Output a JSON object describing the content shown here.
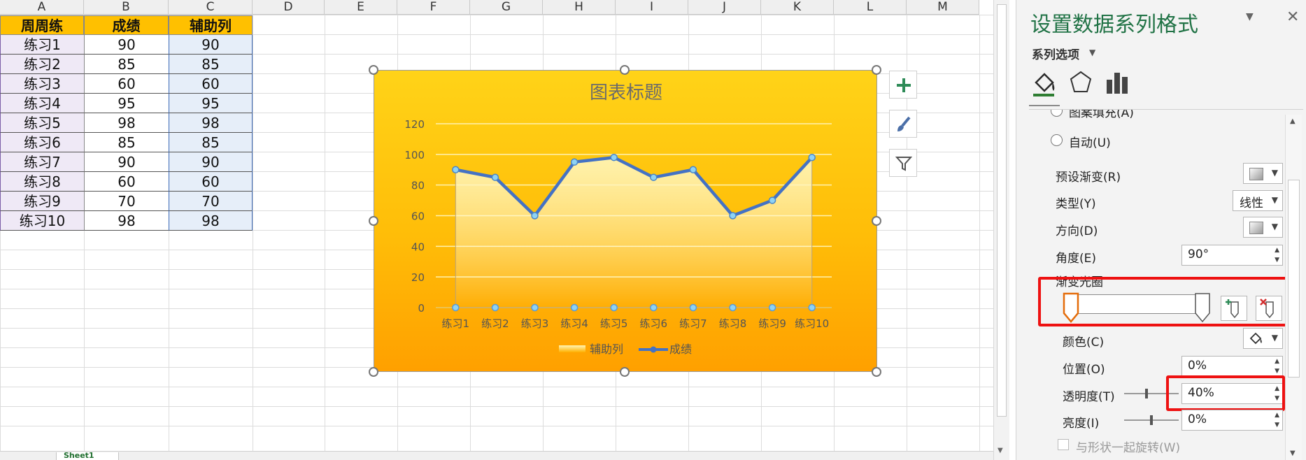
{
  "spreadsheet": {
    "columns": [
      "A",
      "B",
      "C",
      "D",
      "E",
      "F",
      "G",
      "H",
      "I",
      "J",
      "K",
      "L",
      "M"
    ],
    "headers": [
      "周周练",
      "成绩",
      "辅助列"
    ],
    "rows": [
      [
        "练习1",
        "90",
        "90"
      ],
      [
        "练习2",
        "85",
        "85"
      ],
      [
        "练习3",
        "60",
        "60"
      ],
      [
        "练习4",
        "95",
        "95"
      ],
      [
        "练习5",
        "98",
        "98"
      ],
      [
        "练习6",
        "85",
        "85"
      ],
      [
        "练习7",
        "90",
        "90"
      ],
      [
        "练习8",
        "60",
        "60"
      ],
      [
        "练习9",
        "70",
        "70"
      ],
      [
        "练习10",
        "98",
        "98"
      ]
    ],
    "sheet_tab": "Sheet1"
  },
  "chart_data": {
    "type": "line",
    "title": "图表标题",
    "categories": [
      "练习1",
      "练习2",
      "练习3",
      "练习4",
      "练习5",
      "练习6",
      "练习7",
      "练习8",
      "练习9",
      "练习10"
    ],
    "series": [
      {
        "name": "辅助列",
        "type": "area",
        "values": [
          90,
          85,
          60,
          95,
          98,
          85,
          90,
          60,
          70,
          98
        ]
      },
      {
        "name": "成绩",
        "type": "line",
        "values": [
          90,
          85,
          60,
          95,
          98,
          85,
          90,
          60,
          70,
          98
        ]
      }
    ],
    "ylim": [
      0,
      120
    ],
    "yticks": [
      0,
      20,
      40,
      60,
      80,
      100,
      120
    ],
    "grid": true,
    "legend": "bottom",
    "colors": {
      "line": "#4472c4",
      "area_top": "#fff4b3",
      "background_top": "#ffd318",
      "background_bottom": "#ffa000"
    }
  },
  "pane": {
    "title": "设置数据系列格式",
    "section": "系列选项",
    "clipped_label": "图案填充(A)",
    "auto_label": "自动(U)",
    "preset_label": "预设渐变(R)",
    "type_label": "类型(Y)",
    "type_value": "线性",
    "direction_label": "方向(D)",
    "angle_label": "角度(E)",
    "angle_value": "90°",
    "stops_label": "渐变光圈",
    "color_label": "颜色(C)",
    "position_label": "位置(O)",
    "position_value": "0%",
    "transparency_label": "透明度(T)",
    "transparency_value": "40%",
    "transparency_level": 0.4,
    "brightness_label": "亮度(I)",
    "brightness_value": "0%",
    "rotate_label": "与形状一起旋转(W)"
  }
}
